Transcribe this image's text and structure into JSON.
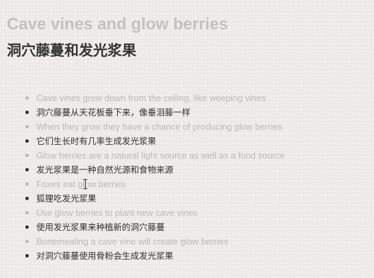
{
  "heading": {
    "title_en": "Cave vines and glow berries",
    "title_zh": "洞穴藤蔓和发光浆果"
  },
  "items": [
    {
      "lang": "en",
      "text": "Cave vines grow down from the ceiling, like weeping vines"
    },
    {
      "lang": "zh",
      "text": "洞穴藤蔓从天花板垂下来，像垂泪藤一样"
    },
    {
      "lang": "en",
      "text": "When they grow they have a chance of producing glow berries"
    },
    {
      "lang": "zh",
      "text": "它们生长时有几率生成发光浆果"
    },
    {
      "lang": "en",
      "text": "Glow berries are a natural light source as well as a food source"
    },
    {
      "lang": "zh",
      "text": "发光浆果是一种自然光源和食物来源"
    },
    {
      "lang": "en",
      "text": "Foxes eat glow berries"
    },
    {
      "lang": "zh",
      "text": "狐狸吃发光浆果"
    },
    {
      "lang": "en",
      "text": "Use glow berries to plant new cave vines"
    },
    {
      "lang": "zh",
      "text": "使用发光浆果来种植新的洞穴藤蔓"
    },
    {
      "lang": "en",
      "text": "Bonemealing a cave vine will create glow berries"
    },
    {
      "lang": "zh",
      "text": "对洞穴藤蔓使用骨粉会生成发光浆果"
    }
  ],
  "colors": {
    "background": "#eeecea",
    "english_text": "#b9b9b9",
    "chinese_text": "#2f2f2f",
    "title_en": "#c2c2c2",
    "title_zh": "#333333"
  },
  "cursor": {
    "icon": "text-cursor-icon"
  }
}
